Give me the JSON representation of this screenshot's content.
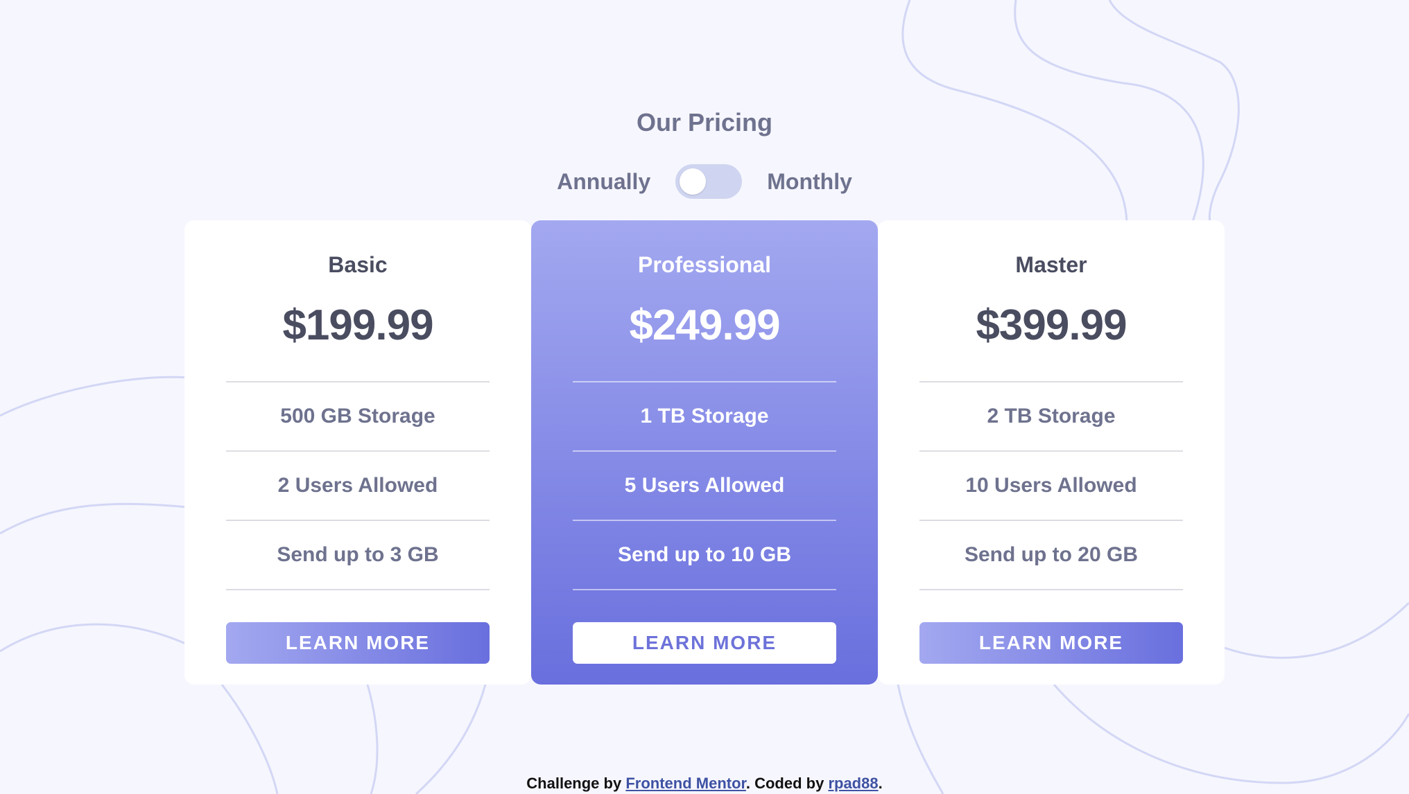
{
  "header": {
    "title": "Our Pricing"
  },
  "billing_toggle": {
    "left_label": "Annually",
    "right_label": "Monthly"
  },
  "plans": [
    {
      "name": "Basic",
      "price": "$199.99",
      "features": [
        "500 GB Storage",
        "2 Users Allowed",
        "Send up to 3 GB"
      ],
      "button_label": "LEARN MORE"
    },
    {
      "name": "Professional",
      "price": "$249.99",
      "features": [
        "1 TB Storage",
        "5 Users Allowed",
        "Send up to 10 GB"
      ],
      "button_label": "LEARN MORE"
    },
    {
      "name": "Master",
      "price": "$399.99",
      "features": [
        "2 TB Storage",
        "10 Users Allowed",
        "Send up to 20 GB"
      ],
      "button_label": "LEARN MORE"
    }
  ],
  "footer": {
    "challenge_prefix": "Challenge by ",
    "challenge_link": "Frontend Mentor",
    "coded_prefix": ". Coded by ",
    "author_link": "rpad88",
    "suffix": "."
  },
  "colors": {
    "background": "#f6f6fe",
    "accent_start": "#a3a8f0",
    "accent_end": "#696fdd",
    "text_dark": "#4a4d60",
    "text_muted": "#6e728e"
  }
}
